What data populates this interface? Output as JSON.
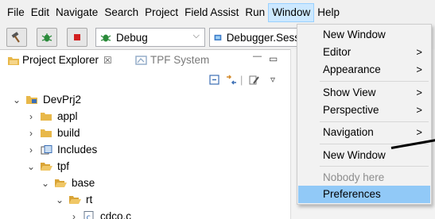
{
  "menubar": {
    "items": [
      "File",
      "Edit",
      "Navigate",
      "Search",
      "Project",
      "Field Assist",
      "Run",
      "Window",
      "Help"
    ],
    "open_item": "Window"
  },
  "toolbar": {
    "debug_combo": "Debug",
    "session_combo": "Debugger.Sess"
  },
  "explorer": {
    "tabs": [
      {
        "label": "Project Explorer",
        "active": true,
        "close": "☒"
      },
      {
        "label": "TPF System",
        "active": false
      }
    ],
    "tree": [
      {
        "label": "DevPrj2",
        "twisty": "⌄",
        "icon": "project-icon"
      },
      {
        "label": "appl",
        "twisty": "›",
        "icon": "folder-icon"
      },
      {
        "label": "build",
        "twisty": "›",
        "icon": "folder-icon"
      },
      {
        "label": "Includes",
        "twisty": "›",
        "icon": "includes-icon"
      },
      {
        "label": "tpf",
        "twisty": "⌄",
        "icon": "folder-open-icon"
      },
      {
        "label": "base",
        "twisty": "⌄",
        "icon": "folder-open-icon"
      },
      {
        "label": "rt",
        "twisty": "⌄",
        "icon": "folder-open-icon"
      },
      {
        "label": "cdco.c",
        "twisty": "›",
        "icon": "c-file-icon"
      }
    ]
  },
  "window_menu": {
    "items": [
      {
        "label": "New Window",
        "submenu": false,
        "disabled": false,
        "selected": false
      },
      {
        "label": "Editor",
        "submenu": true,
        "disabled": false,
        "selected": false
      },
      {
        "label": "Appearance",
        "submenu": true,
        "disabled": false,
        "selected": false
      },
      {
        "label": "Show View",
        "submenu": true,
        "disabled": false,
        "selected": false
      },
      {
        "label": "Perspective",
        "submenu": true,
        "disabled": false,
        "selected": false
      },
      {
        "label": "Navigation",
        "submenu": true,
        "disabled": false,
        "selected": false
      },
      {
        "label": "New Window",
        "submenu": false,
        "disabled": false,
        "selected": false
      },
      {
        "label": "Nobody here",
        "submenu": false,
        "disabled": true,
        "selected": false
      },
      {
        "label": "Preferences",
        "submenu": false,
        "disabled": false,
        "selected": true
      }
    ],
    "submenu_glyph": ">"
  },
  "colors": {
    "menu_open_bg": "#cce8ff",
    "selected_item_bg": "#91c9f7",
    "folder": "#e8b84a",
    "disabled_text": "#8d8d8d"
  }
}
